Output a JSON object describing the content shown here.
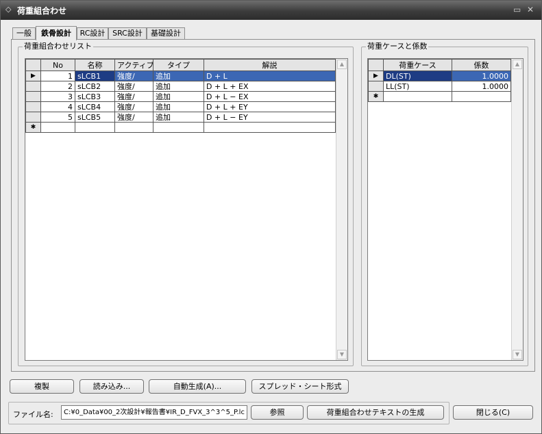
{
  "window": {
    "title": "荷重組合わせ",
    "title_icon": "◇",
    "minimize": "▭",
    "close": "✕"
  },
  "tabs": [
    "一般",
    "鉄骨設計",
    "RC設計",
    "SRC設計",
    "基礎設計"
  ],
  "combo_list": {
    "title": "荷重組合わせリスト",
    "columns": [
      "No",
      "名称",
      "アクティブ",
      "タイプ",
      "解説"
    ],
    "rows": [
      {
        "no": "1",
        "name": "sLCB1",
        "active": "強度/",
        "type": "追加",
        "desc": "D + L"
      },
      {
        "no": "2",
        "name": "sLCB2",
        "active": "強度/",
        "type": "追加",
        "desc": "D + L + EX"
      },
      {
        "no": "3",
        "name": "sLCB3",
        "active": "強度/",
        "type": "追加",
        "desc": "D + L − EX"
      },
      {
        "no": "4",
        "name": "sLCB4",
        "active": "強度/",
        "type": "追加",
        "desc": "D + L + EY"
      },
      {
        "no": "5",
        "name": "sLCB5",
        "active": "強度/",
        "type": "追加",
        "desc": "D + L − EY"
      }
    ],
    "new_row_marker": "✱",
    "current_row_marker": "▶"
  },
  "case_list": {
    "title": "荷重ケースと係数",
    "columns": [
      "荷重ケース",
      "係数"
    ],
    "rows": [
      {
        "case": "DL(ST)",
        "factor": "1.0000"
      },
      {
        "case": "LL(ST)",
        "factor": "1.0000"
      }
    ],
    "new_row_marker": "✱",
    "current_row_marker": "▶"
  },
  "buttons": {
    "copy": "複製",
    "import": "読み込み...",
    "auto": "自動生成(A)...",
    "spread": "スプレッド・シート形式",
    "browse": "参照",
    "generate_text": "荷重組合わせテキストの生成",
    "close": "閉じる(C)"
  },
  "file": {
    "label": "ファイル名:",
    "value": "C:¥0_Data¥00_2次設計¥報告書¥IR_D_FVX_3^3^5_P.lc"
  },
  "scroll": {
    "up": "▲",
    "down": "▼"
  }
}
